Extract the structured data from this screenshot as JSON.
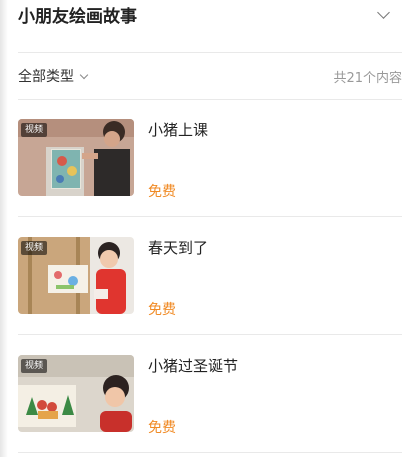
{
  "header": {
    "title": "小朋友绘画故事"
  },
  "filter": {
    "type_label": "全部类型",
    "count_label": "共21个内容"
  },
  "items": [
    {
      "badge": "视频",
      "title": "小猪上课",
      "price": "免费"
    },
    {
      "badge": "视频",
      "title": "春天到了",
      "price": "免费"
    },
    {
      "badge": "视频",
      "title": "小猪过圣诞节",
      "price": "免费"
    }
  ],
  "colors": {
    "price": "#f08a24",
    "divider": "#e9e9e9"
  },
  "icons": {
    "header_toggle": "chevron-down-icon",
    "filter_dropdown": "chevron-down-icon"
  }
}
